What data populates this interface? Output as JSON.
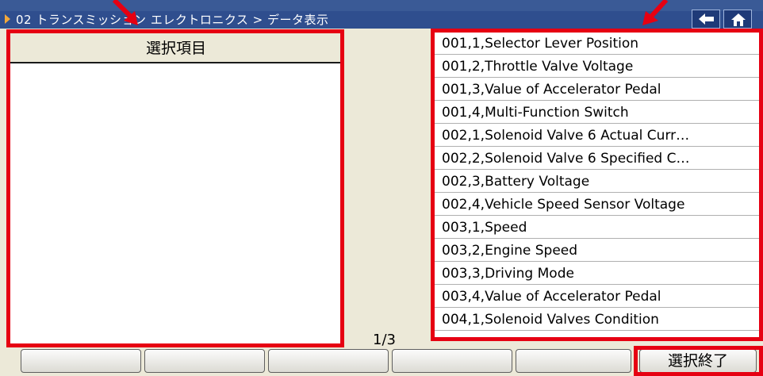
{
  "title": {
    "text": "02 トランスミッション エレクトロニクス > データ表示"
  },
  "left_panel": {
    "header": "選択項目"
  },
  "page_indicator": "1/3",
  "list_items": [
    "001,1,Selector Lever Position",
    "001,2,Throttle Valve Voltage",
    "001,3,Value of Accelerator Pedal",
    "001,4,Multi-Function Switch",
    "002,1,Solenoid Valve 6 Actual Curr…",
    "002,2,Solenoid Valve 6 Specified C…",
    "002,3,Battery Voltage",
    "002,4,Vehicle Speed Sensor Voltage",
    "003,1,Speed",
    "003,2,Engine Speed",
    "003,3,Driving Mode",
    "003,4,Value of Accelerator Pedal",
    "004,1,Solenoid Valves Condition"
  ],
  "bottom_buttons": [
    "",
    "",
    "",
    "",
    "",
    "選択終了"
  ],
  "icons": {
    "back": "arrow-left-icon",
    "home": "home-icon"
  },
  "colors": {
    "title_bg": "#2f4e8e",
    "annotation": "#e60012",
    "title_arrow": "#f4a83a"
  }
}
